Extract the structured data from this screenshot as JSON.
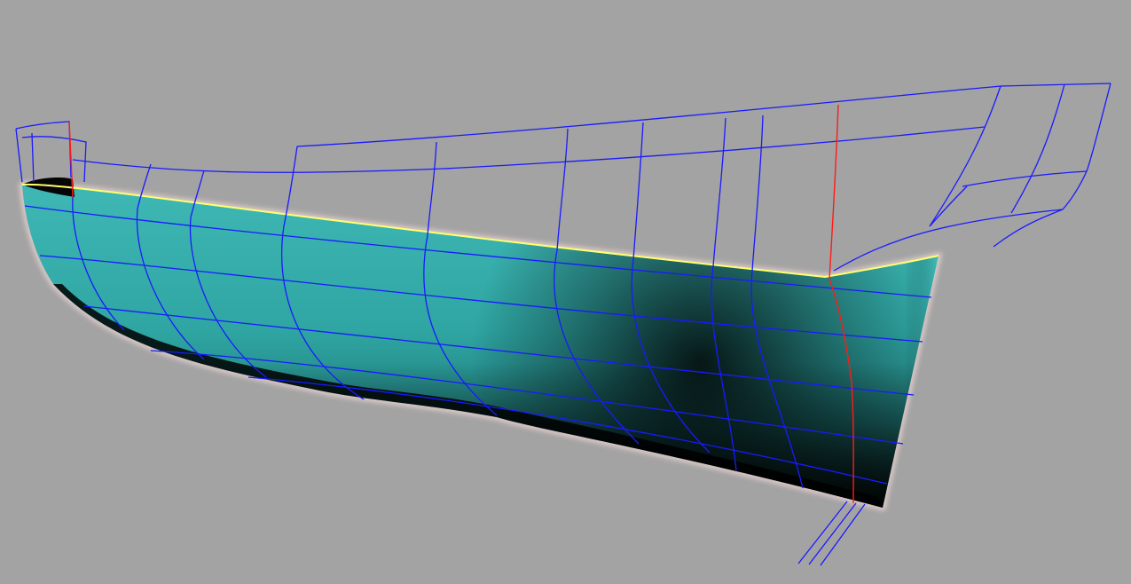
{
  "viewport": {
    "background_color": "#a3a3a3",
    "render_mode": "shaded-with-wireframe",
    "model": "hull-surface"
  },
  "colors": {
    "hull_highlight": "#3fb7b4",
    "hull_mid": "#2a9a97",
    "hull_shadow": "#071818",
    "wire_blue": "#1a1aff",
    "wire_red": "#ff1a1a",
    "sheer_edge": "#ffff6e",
    "edge_glow": "#ffe2e0"
  },
  "wireframe": {
    "stations_count": 12,
    "waterlines_count": 5,
    "centerline_color": "red"
  }
}
